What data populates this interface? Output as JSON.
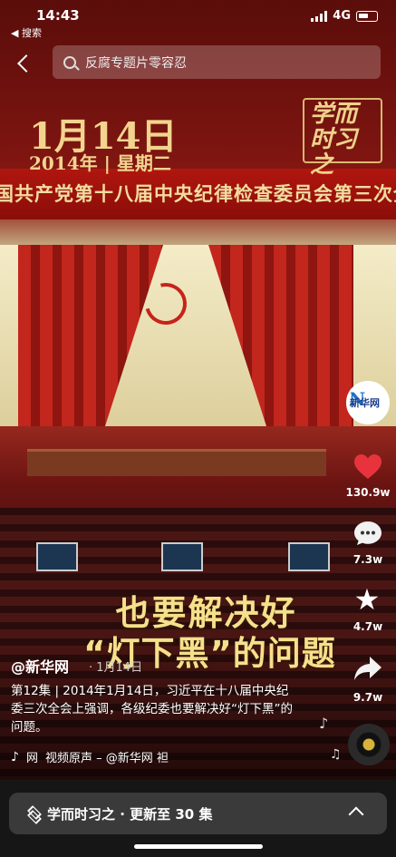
{
  "status": {
    "time": "14:43",
    "back_app": "◀ 搜索",
    "network": "4G"
  },
  "search": {
    "placeholder": "反腐专题片零容忍"
  },
  "video": {
    "date_main": "1月14日",
    "date_sub": "2014年 | 星期二",
    "banner": "国共产党第十八届中央纪律检查委员会第三次全体会议",
    "logo": "学而时习之",
    "caption_line1": "也要解决好",
    "caption_line2": "“灯下黑”的问题"
  },
  "actions": {
    "likes": "130.9w",
    "comments": "7.3w",
    "favorites": "4.7w",
    "shares": "9.7w",
    "avatar_label": "新华网"
  },
  "post": {
    "author": "@新华网",
    "date": "· 1月14日",
    "description": "第12集 | 2014年1月14日，习近平在十八届中央纪委三次全会上强调，各级纪委也要解决好“灯下黑”的问题。",
    "music_prefix": "网",
    "music": "视频原声 – @新华网  袒"
  },
  "collection": {
    "label": "学而时习之 · 更新至 30 集"
  },
  "colors": {
    "accent_red": "#e8333d",
    "caption_gold": "#f5e08c"
  }
}
